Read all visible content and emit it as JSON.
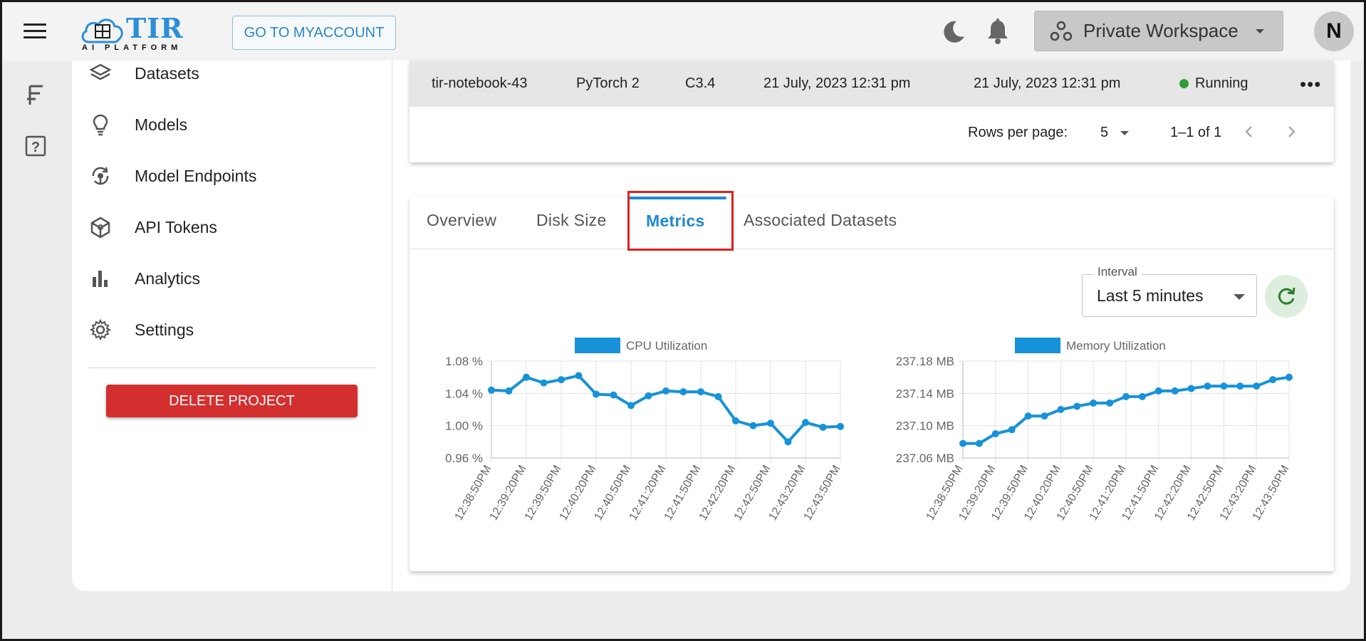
{
  "header": {
    "logo_text": "TIR",
    "logo_subtitle": "AI PLATFORM",
    "myaccount_label": "GO TO MYACCOUNT",
    "workspace_label": "Private Workspace",
    "avatar_initial": "N"
  },
  "sidebar": {
    "items": [
      {
        "label": "Datasets",
        "icon": "layers-icon"
      },
      {
        "label": "Models",
        "icon": "lightbulb-icon"
      },
      {
        "label": "Model Endpoints",
        "icon": "endpoint-icon"
      },
      {
        "label": "API Tokens",
        "icon": "cube-icon"
      },
      {
        "label": "Analytics",
        "icon": "bar-chart-icon"
      },
      {
        "label": "Settings",
        "icon": "gear-icon"
      }
    ],
    "delete_label": "DELETE PROJECT"
  },
  "table": {
    "row": {
      "name": "tir-notebook-43",
      "image": "PyTorch 2",
      "plan": "C3.4",
      "created": "21 July, 2023 12:31 pm",
      "updated": "21 July, 2023 12:31 pm",
      "status": "Running"
    },
    "rows_per_page_label": "Rows per page:",
    "rows_per_page_value": "5",
    "range": "1–1 of 1"
  },
  "tabs": [
    {
      "label": "Overview"
    },
    {
      "label": "Disk Size"
    },
    {
      "label": "Metrics"
    },
    {
      "label": "Associated Datasets"
    }
  ],
  "interval": {
    "label": "Interval",
    "value": "Last 5 minutes"
  },
  "colors": {
    "accent": "#1e88d2",
    "series": "#1692d9",
    "danger": "#d32f2f",
    "running": "#2e9d3a"
  },
  "chart_data": [
    {
      "type": "line",
      "title": "",
      "series": [
        {
          "name": "CPU Utilization",
          "values": [
            1.044,
            1.043,
            1.06,
            1.053,
            1.057,
            1.062,
            1.039,
            1.038,
            1.025,
            1.037,
            1.043,
            1.042,
            1.042,
            1.036,
            1.006,
            1.0,
            1.003,
            0.98,
            1.004,
            0.998,
            0.999
          ]
        }
      ],
      "x_tick_labels": [
        "12:38:50PM",
        "12:39:20PM",
        "12:39:50PM",
        "12:40:20PM",
        "12:40:50PM",
        "12:41:20PM",
        "12:41:50PM",
        "12:42:20PM",
        "12:42:50PM",
        "12:43:20PM",
        "12:43:50PM"
      ],
      "y_ticks": [
        "1.08 %",
        "1.04 %",
        "1.00 %",
        "0.96 %"
      ],
      "ylim": [
        0.96,
        1.08
      ],
      "grid": true,
      "legend": "top"
    },
    {
      "type": "line",
      "title": "",
      "series": [
        {
          "name": "Memory Utilization",
          "values": [
            237.078,
            237.078,
            237.09,
            237.095,
            237.112,
            237.112,
            237.12,
            237.124,
            237.128,
            237.128,
            237.136,
            237.136,
            237.143,
            237.143,
            237.146,
            237.149,
            237.149,
            237.149,
            237.149,
            237.157,
            237.16
          ]
        }
      ],
      "x_tick_labels": [
        "12:38:50PM",
        "12:39:20PM",
        "12:39:50PM",
        "12:40:20PM",
        "12:40:50PM",
        "12:41:20PM",
        "12:41:50PM",
        "12:42:20PM",
        "12:42:50PM",
        "12:43:20PM",
        "12:43:50PM"
      ],
      "y_ticks": [
        "237.18 MB",
        "237.14 MB",
        "237.10 MB",
        "237.06 MB"
      ],
      "ylim": [
        237.06,
        237.18
      ],
      "grid": true,
      "legend": "top"
    }
  ]
}
